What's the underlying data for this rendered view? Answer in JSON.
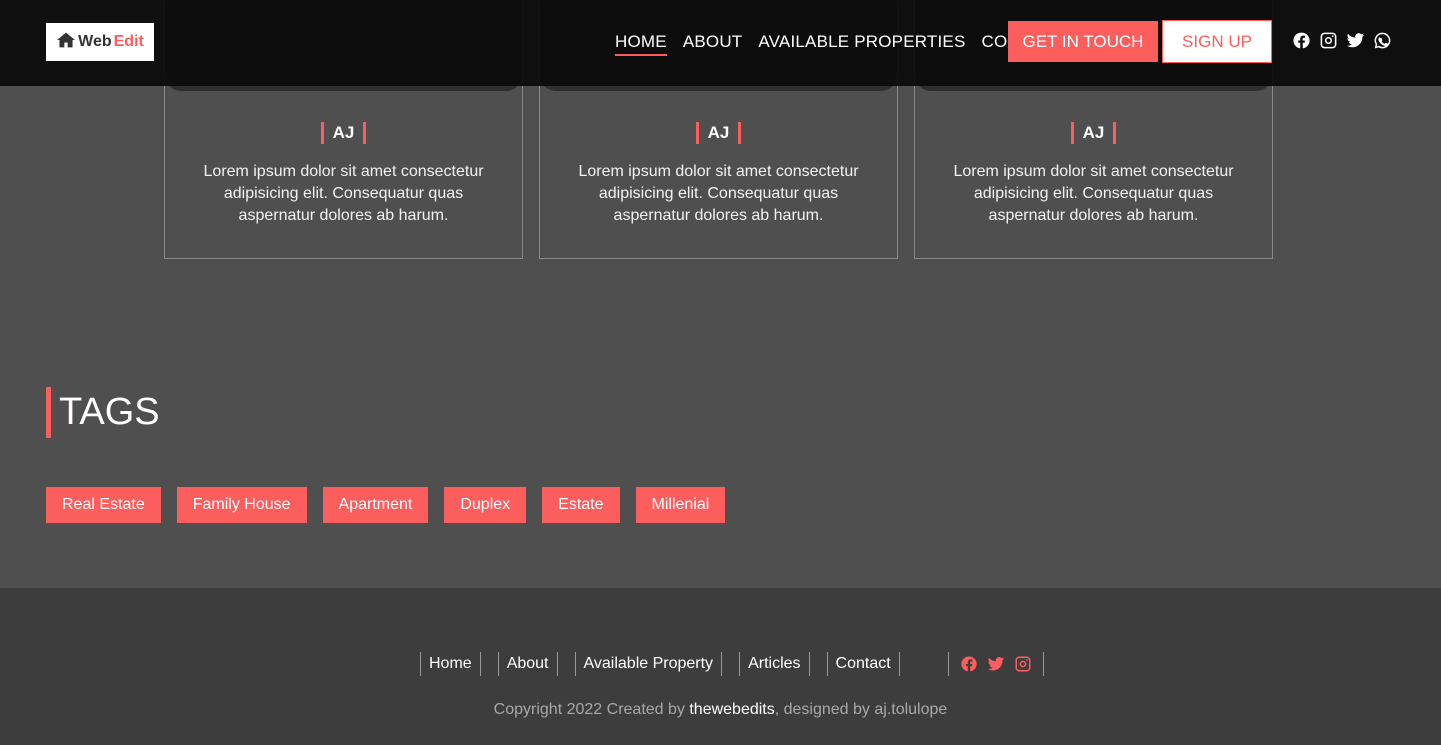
{
  "header": {
    "logo": {
      "prefix": "Web",
      "accent": "Edit",
      "icon": "house-icon"
    },
    "nav": [
      {
        "label": "HOME",
        "active": true
      },
      {
        "label": "ABOUT",
        "active": false
      },
      {
        "label": "AVAILABLE PROPERTIES",
        "active": false
      },
      {
        "label": "CONTACT",
        "active": false
      }
    ],
    "cta_label": "GET IN TOUCH",
    "signup_label": "SIGN UP",
    "social": [
      "facebook-icon",
      "instagram-icon",
      "twitter-icon",
      "whatsapp-icon"
    ]
  },
  "testimonials": [
    {
      "initials": "AJ",
      "text": "Lorem ipsum dolor sit amet consectetur adipisicing elit. Consequatur quas aspernatur dolores ab harum."
    },
    {
      "initials": "AJ",
      "text": "Lorem ipsum dolor sit amet consectetur adipisicing elit. Consequatur quas aspernatur dolores ab harum."
    },
    {
      "initials": "AJ",
      "text": "Lorem ipsum dolor sit amet consectetur adipisicing elit. Consequatur quas aspernatur dolores ab harum."
    }
  ],
  "tags": {
    "title": "TAGS",
    "items": [
      "Real Estate",
      "Family House",
      "Apartment",
      "Duplex",
      "Estate",
      "Millenial"
    ]
  },
  "footer": {
    "links": [
      "Home",
      "About",
      "Available Property",
      "Articles",
      "Contact"
    ],
    "social": [
      "facebook-icon",
      "twitter-icon",
      "instagram-icon"
    ],
    "copyright": {
      "prefix": "Copyright 2022 Created by ",
      "brand": "thewebedits",
      "suffix": ", designed by aj.tolulope"
    }
  },
  "colors": {
    "accent": "#fc5d5d",
    "header_bg": "#0c0c0c",
    "body_bg": "#4f4f4f",
    "footer_bg": "#3d3d3d"
  }
}
